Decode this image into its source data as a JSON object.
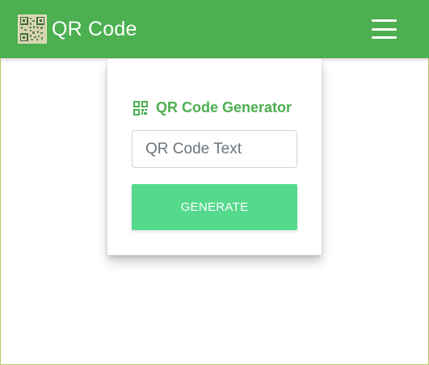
{
  "navbar": {
    "brand_title": "QR Code",
    "background": "#4caf50",
    "menu_icon": "hamburger-menu-icon"
  },
  "card": {
    "title": "QR Code Generator",
    "title_icon": "qr-code-icon",
    "title_color": "#4caf50",
    "input": {
      "value": "",
      "placeholder": "QR Code Text"
    },
    "generate_label": "GENERATE",
    "button_color": "#55d98c"
  }
}
